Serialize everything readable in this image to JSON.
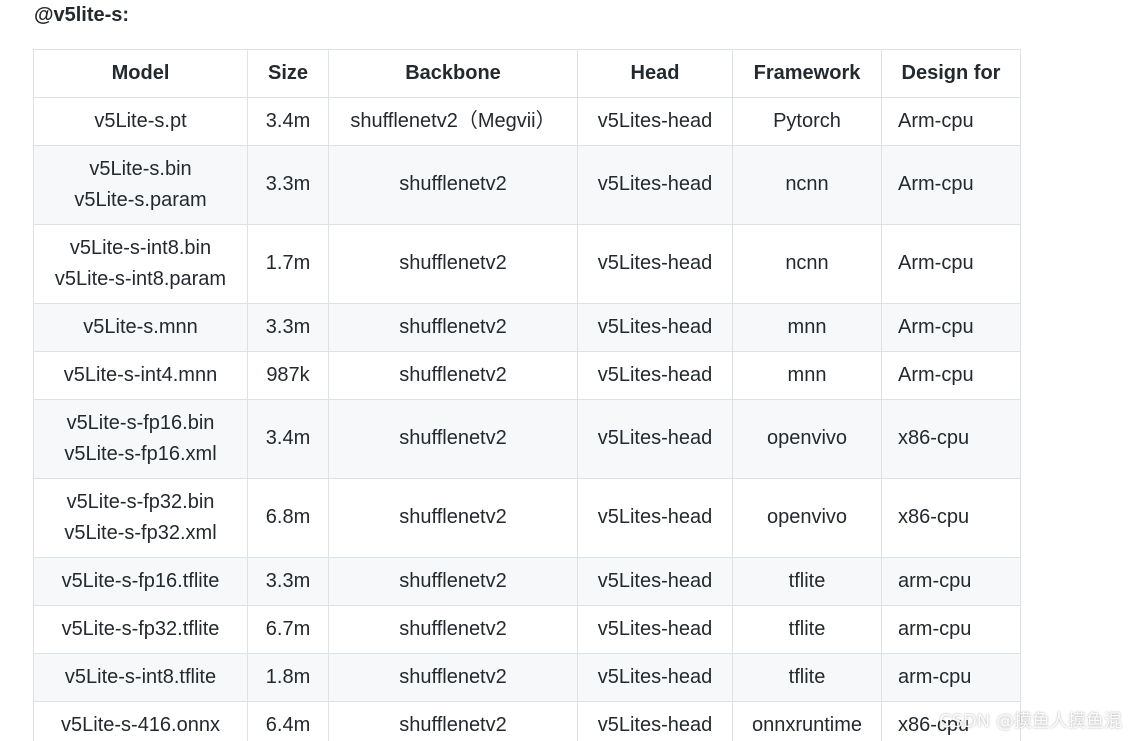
{
  "heading": "@v5lite-s:",
  "table": {
    "headers": [
      "Model",
      "Size",
      "Backbone",
      "Head",
      "Framework",
      "Design for"
    ],
    "rows": [
      {
        "model": [
          "v5Lite-s.pt"
        ],
        "size": "3.4m",
        "backbone": "shufflenetv2（Megvii）",
        "head": "v5Lites-head",
        "framework": "Pytorch",
        "design_for": "Arm-cpu"
      },
      {
        "model": [
          "v5Lite-s.bin",
          "v5Lite-s.param"
        ],
        "size": "3.3m",
        "backbone": "shufflenetv2",
        "head": "v5Lites-head",
        "framework": "ncnn",
        "design_for": "Arm-cpu"
      },
      {
        "model": [
          "v5Lite-s-int8.bin",
          "v5Lite-s-int8.param"
        ],
        "size": "1.7m",
        "backbone": "shufflenetv2",
        "head": "v5Lites-head",
        "framework": "ncnn",
        "design_for": "Arm-cpu"
      },
      {
        "model": [
          "v5Lite-s.mnn"
        ],
        "size": "3.3m",
        "backbone": "shufflenetv2",
        "head": "v5Lites-head",
        "framework": "mnn",
        "design_for": "Arm-cpu"
      },
      {
        "model": [
          "v5Lite-s-int4.mnn"
        ],
        "size": "987k",
        "backbone": "shufflenetv2",
        "head": "v5Lites-head",
        "framework": "mnn",
        "design_for": "Arm-cpu"
      },
      {
        "model": [
          "v5Lite-s-fp16.bin",
          "v5Lite-s-fp16.xml"
        ],
        "size": "3.4m",
        "backbone": "shufflenetv2",
        "head": "v5Lites-head",
        "framework": "openvivo",
        "design_for": "x86-cpu"
      },
      {
        "model": [
          "v5Lite-s-fp32.bin",
          "v5Lite-s-fp32.xml"
        ],
        "size": "6.8m",
        "backbone": "shufflenetv2",
        "head": "v5Lites-head",
        "framework": "openvivo",
        "design_for": "x86-cpu"
      },
      {
        "model": [
          "v5Lite-s-fp16.tflite"
        ],
        "size": "3.3m",
        "backbone": "shufflenetv2",
        "head": "v5Lites-head",
        "framework": "tflite",
        "design_for": "arm-cpu"
      },
      {
        "model": [
          "v5Lite-s-fp32.tflite"
        ],
        "size": "6.7m",
        "backbone": "shufflenetv2",
        "head": "v5Lites-head",
        "framework": "tflite",
        "design_for": "arm-cpu"
      },
      {
        "model": [
          "v5Lite-s-int8.tflite"
        ],
        "size": "1.8m",
        "backbone": "shufflenetv2",
        "head": "v5Lites-head",
        "framework": "tflite",
        "design_for": "arm-cpu"
      },
      {
        "model": [
          "v5Lite-s-416.onnx"
        ],
        "size": "6.4m",
        "backbone": "shufflenetv2",
        "head": "v5Lites-head",
        "framework": "onnxruntime",
        "design_for": "x86-cpu"
      }
    ]
  },
  "watermark": "CSDN @摸鱼人摸鱼混"
}
